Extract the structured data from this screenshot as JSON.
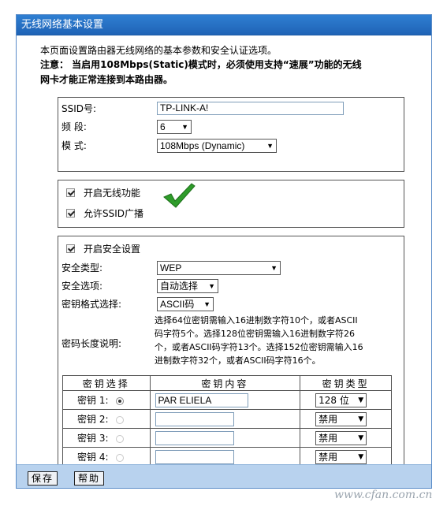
{
  "window": {
    "title": "无线网络基本设置"
  },
  "intro": {
    "description": "本页面设置路由器无线网络的基本参数和安全认证选项。",
    "note_line1": "注意： 当启用108Mbps(Static)模式时，必须使用支持“速展”功能的无线",
    "note_line2": "网卡才能正常连接到本路由器。"
  },
  "basic": {
    "ssid_label": "SSID号:",
    "ssid_value": "TP-LINK-A!",
    "channel_label": "频 段:",
    "channel_value": "6",
    "mode_label": "模 式:",
    "mode_value": "108Mbps (Dynamic)"
  },
  "wireless": {
    "enable_label": "开启无线功能",
    "enable_checked": true,
    "ssid_broadcast_label": "允许SSID广播",
    "ssid_broadcast_checked": true
  },
  "security": {
    "enable_label": "开启安全设置",
    "enable_checked": true,
    "type_label": "安全类型:",
    "type_value": "WEP",
    "option_label": "安全选项:",
    "option_value": "自动选择",
    "format_label": "密钥格式选择:",
    "format_value": "ASCII码",
    "length_label": "密码长度说明:",
    "length_text": [
      "选择64位密钥需输入16进制数字符10个，或者ASCII",
      "码字符5个。选择128位密钥需输入16进制数字符26",
      "个，或者ASCII码字符13个。选择152位密钥需输入16",
      "进制数字符32个，或者ASCII码字符16个。"
    ],
    "table_headers": [
      "密钥选择",
      "密钥内容",
      "密钥类型"
    ],
    "keys": [
      {
        "label": "密钥 1:",
        "selected": true,
        "content": "PAR        ELIELA",
        "type": "128 位"
      },
      {
        "label": "密钥 2:",
        "selected": false,
        "content": "",
        "type": "禁用"
      },
      {
        "label": "密钥 3:",
        "selected": false,
        "content": "",
        "type": "禁用"
      },
      {
        "label": "密钥 4:",
        "selected": false,
        "content": "",
        "type": "禁用"
      }
    ]
  },
  "buttons": {
    "save": "保存",
    "help": "帮助"
  },
  "icons": {
    "dropdown": "triangle-down",
    "check": "green-checkmark"
  },
  "colors": {
    "title_bar": "#1f63b6",
    "bottom_bar": "#b8d2ee",
    "checkmark": "#2e9c2a"
  },
  "watermark": "www.cfan.com.cn"
}
